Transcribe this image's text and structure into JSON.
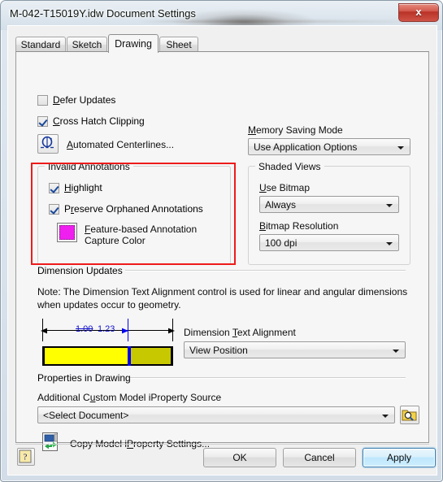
{
  "window": {
    "title": "M-042-T15019Y.idw Document Settings",
    "close_label": "x"
  },
  "tabs": [
    {
      "label": "Standard",
      "active": false
    },
    {
      "label": "Sketch",
      "active": false
    },
    {
      "label": "Drawing",
      "active": true
    },
    {
      "label": "Sheet",
      "active": false
    }
  ],
  "drawing": {
    "defer_updates": {
      "label": "Defer Updates",
      "checked": false
    },
    "cross_hatch_clipping": {
      "label": "Cross Hatch Clipping",
      "checked": true
    },
    "automated_centerlines": {
      "label": "Automated Centerlines...",
      "icon": "centerline-icon"
    },
    "invalid_annotations": {
      "title": "Invalid Annotations",
      "highlight": {
        "label": "Highlight",
        "checked": true
      },
      "preserve_orphaned": {
        "label": "Preserve Orphaned Annotations",
        "checked": true
      },
      "capture_color": {
        "label_line1": "Feature-based Annotation Capture",
        "label_line2": "Color",
        "color": "#ef20ef"
      }
    },
    "memory_saving_mode": {
      "label": "Memory Saving Mode",
      "value": "Use Application Options"
    },
    "shaded_views": {
      "title": "Shaded Views",
      "use_bitmap": {
        "label": "Use Bitmap",
        "value": "Always"
      },
      "bitmap_resolution": {
        "label": "Bitmap Resolution",
        "value": "100 dpi"
      }
    },
    "dimension_updates": {
      "section_label": "Dimension Updates",
      "note": "Note: The Dimension Text Alignment control is used for linear and angular dimensions when updates occur to geometry.",
      "preview": {
        "old_value": "1.00",
        "new_value": "1.23",
        "bar_left_color": "#ffff00",
        "bar_right_color": "#c8c800",
        "divider_color": "#0000ee"
      },
      "text_alignment": {
        "label": "Dimension Text Alignment",
        "value": "View Position"
      }
    },
    "properties_in_drawing": {
      "section_label": "Properties in Drawing",
      "source_label": "Additional Custom Model iProperty Source",
      "source_value": "<Select Document>",
      "browse_icon": "folder-search-icon",
      "copy_settings": {
        "label": "Copy Model iProperty Settings...",
        "icon": "copy-iproperty-icon"
      }
    }
  },
  "footer": {
    "help_label": "?",
    "ok_label": "OK",
    "cancel_label": "Cancel",
    "apply_label": "Apply"
  },
  "annotations": {
    "highlight_color": "#ee1b1b"
  }
}
